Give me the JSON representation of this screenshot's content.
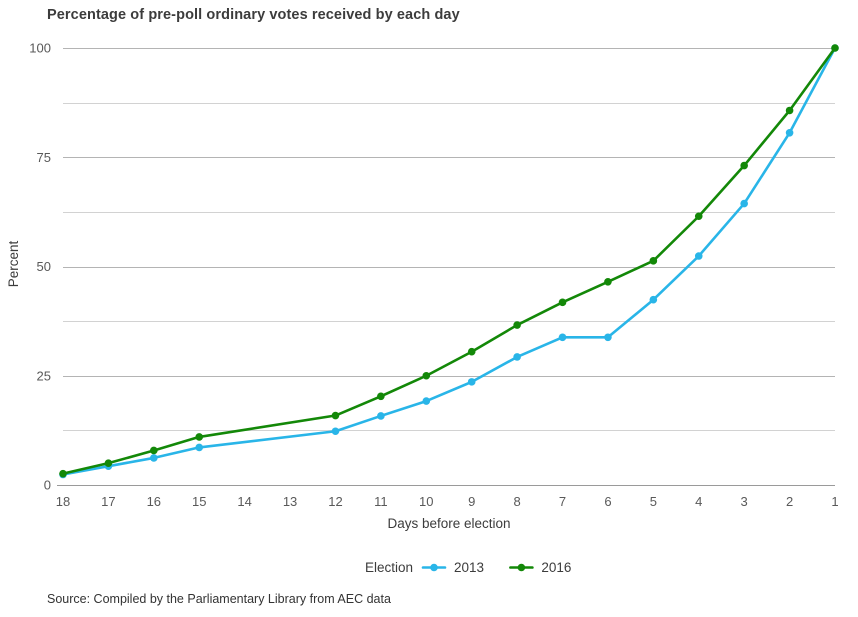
{
  "chart_data": {
    "type": "line",
    "title": "Percentage of pre-poll ordinary votes received by each day",
    "xlabel": "Days before election",
    "ylabel": "Percent",
    "categories": [
      "18",
      "17",
      "16",
      "15",
      "14",
      "13",
      "12",
      "11",
      "10",
      "9",
      "8",
      "7",
      "6",
      "5",
      "4",
      "3",
      "2",
      "1"
    ],
    "x": [
      18,
      17,
      16,
      15,
      14,
      13,
      12,
      11,
      10,
      9,
      8,
      7,
      6,
      5,
      4,
      3,
      2,
      1
    ],
    "series": [
      {
        "name": "2013",
        "color": "#29B5E8",
        "values": [
          2.4,
          4.3,
          6.2,
          8.6,
          null,
          null,
          12.3,
          15.8,
          19.2,
          23.6,
          29.3,
          33.8,
          33.8,
          42.4,
          52.4,
          64.4,
          80.6,
          100.0
        ],
        "markers": [
          true,
          true,
          true,
          true,
          false,
          false,
          true,
          true,
          true,
          true,
          true,
          true,
          true,
          true,
          true,
          true,
          true,
          true
        ]
      },
      {
        "name": "2016",
        "color": "#138808",
        "values": [
          2.6,
          5.0,
          7.9,
          11.0,
          null,
          null,
          15.9,
          20.3,
          25.0,
          30.5,
          36.6,
          41.8,
          46.5,
          51.3,
          61.5,
          73.1,
          85.7,
          100.0
        ],
        "markers": [
          true,
          true,
          true,
          true,
          false,
          false,
          true,
          true,
          true,
          true,
          true,
          true,
          true,
          true,
          true,
          true,
          true,
          true
        ]
      }
    ],
    "ylim": [
      0,
      100
    ],
    "y_major_ticks": [
      0,
      25,
      50,
      75,
      100
    ],
    "y_minor_ticks": [
      12.5,
      37.5,
      62.5,
      87.5
    ],
    "y_tick_labels": [
      "0",
      "25",
      "50",
      "75",
      "100"
    ],
    "grid": true,
    "legend_position": "bottom",
    "legend_title": "Election"
  },
  "legend": {
    "title": "Election",
    "entries": [
      {
        "label": "2013",
        "color": "#29B5E8"
      },
      {
        "label": "2016",
        "color": "#138808"
      }
    ]
  },
  "footer": {
    "source": "Source: Compiled by the Parliamentary Library from AEC data"
  }
}
